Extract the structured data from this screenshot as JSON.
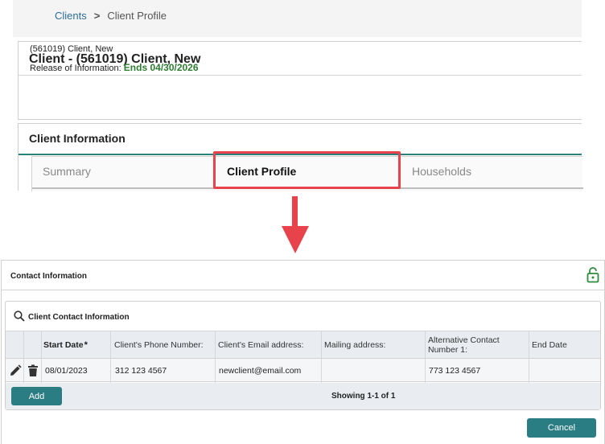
{
  "breadcrumb": {
    "parent": "Clients",
    "separator": ">",
    "current": "Client Profile"
  },
  "client": {
    "title": "Client - (561019) Client, New",
    "subtitle": "(561019) Client, New",
    "roi_label": "Release of Information:",
    "roi_value": "Ends 04/30/2026"
  },
  "client_information": {
    "title": "Client Information",
    "tabs": [
      {
        "label": "Summary",
        "active": false
      },
      {
        "label": "Client Profile",
        "active": true
      },
      {
        "label": "Households",
        "active": false
      }
    ]
  },
  "contact_information": {
    "title": "Contact Information",
    "section_title": "Client Contact Information",
    "columns": [
      {
        "label": "Start Date",
        "required_mark": "*"
      },
      {
        "label": "Client's Phone Number:"
      },
      {
        "label": "Client's Email address:"
      },
      {
        "label": "Mailing address:"
      },
      {
        "label": "Alternative Contact Number 1:"
      },
      {
        "label": "End Date"
      }
    ],
    "rows": [
      {
        "start_date": "08/01/2023",
        "phone": "312 123 4567",
        "email": "newclient@email.com",
        "mailing": "",
        "alt_contact": "773 123 4567",
        "end_date": ""
      }
    ],
    "add_label": "Add",
    "showing": "Showing 1-1 of 1",
    "cancel_label": "Cancel"
  },
  "colors": {
    "accent": "#2a7d82",
    "highlight": "#e8434a",
    "roi_green": "#2e7d32",
    "link": "#2a6f97"
  },
  "icons": [
    "search-icon",
    "lock-open-icon",
    "pencil-icon",
    "trash-icon",
    "arrow-down-icon"
  ]
}
